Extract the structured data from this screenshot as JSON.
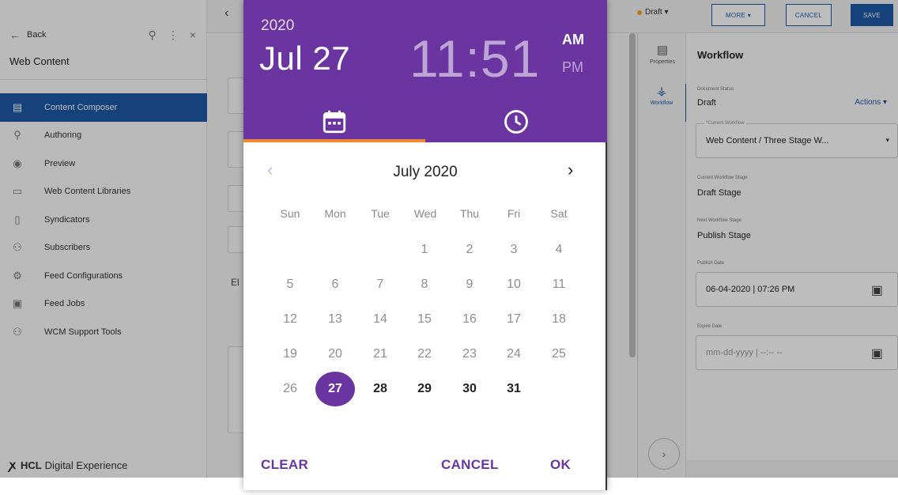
{
  "sidebar": {
    "back_label": "Back",
    "title": "Web Content",
    "items": [
      {
        "label": "Content Composer",
        "icon": "composer-icon",
        "active": true
      },
      {
        "label": "Authoring",
        "icon": "search-icon"
      },
      {
        "label": "Preview",
        "icon": "preview-icon"
      },
      {
        "label": "Web Content Libraries",
        "icon": "folder-icon"
      },
      {
        "label": "Syndicators",
        "icon": "document-icon"
      },
      {
        "label": "Subscribers",
        "icon": "people-icon"
      },
      {
        "label": "Feed Configurations",
        "icon": "gear-icon"
      },
      {
        "label": "Feed Jobs",
        "icon": "clipboard-icon"
      },
      {
        "label": "WCM Support Tools",
        "icon": "people-icon"
      }
    ],
    "brand_hcl": "HCL",
    "brand_rest": "Digital Experience"
  },
  "main": {
    "section_label": "El"
  },
  "toolbar": {
    "status": "Draft",
    "more_label": "MORE",
    "cancel_label": "CANCEL",
    "save_label": "SAVE",
    "accent": "#1e5aa8"
  },
  "rail": {
    "properties_label": "Properties",
    "workflow_label": "Workflow"
  },
  "workflow": {
    "title": "Workflow",
    "doc_status_label": "Document Status",
    "doc_status": "Draft",
    "actions_label": "Actions",
    "current_workflow_label": "*Current Workflow",
    "current_workflow": "Web Content / Three Stage W...",
    "current_stage_label": "Current Workflow Stage",
    "current_stage": "Draft Stage",
    "next_stage_label": "Next Workflow Stage",
    "next_stage": "Publish Stage",
    "publish_date_label": "Publish Date",
    "publish_date": "06-04-2020 | 07:26 PM",
    "expire_date_label": "Expire Date",
    "expire_date_placeholder": "mm-dd-yyyy | --:-- --"
  },
  "picker": {
    "year": "2020",
    "date": "Jul 27",
    "time": "11:51",
    "am": "AM",
    "pm": "PM",
    "month_title": "July 2020",
    "weekdays": [
      "Sun",
      "Mon",
      "Tue",
      "Wed",
      "Thu",
      "Fri",
      "Sat"
    ],
    "first_weekday_index": 3,
    "days_in_month": 31,
    "selected_day": 27,
    "today_range_start": 27,
    "clear_label": "CLEAR",
    "cancel_label": "CANCEL",
    "ok_label": "OK",
    "header_color": "#6a35a0",
    "tab_indicator_color": "#f08a30"
  }
}
